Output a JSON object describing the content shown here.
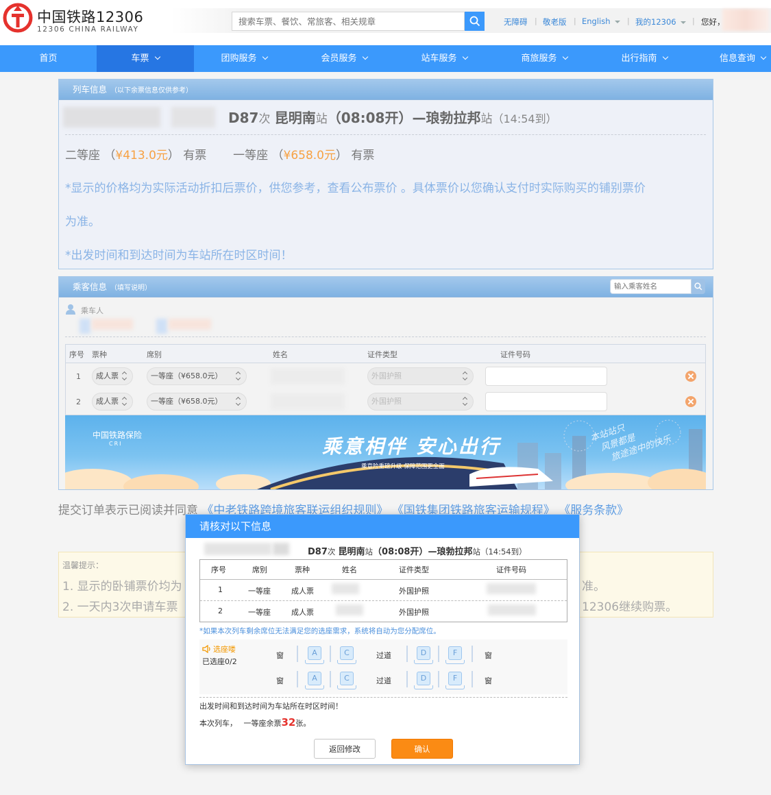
{
  "header": {
    "logo_cn": "中国铁路12306",
    "logo_en": "12306 CHINA RAILWAY",
    "search_placeholder": "搜索车票、餐饮、常旅客、相关规章",
    "links": [
      "无障碍",
      "敬老版",
      "English",
      "我的12306"
    ],
    "greeting": "您好，",
    "brand_color": "#3b99fc"
  },
  "nav": {
    "items": [
      {
        "label": "首页"
      },
      {
        "label": "车票"
      },
      {
        "label": "团购服务"
      },
      {
        "label": "会员服务"
      },
      {
        "label": "站车服务"
      },
      {
        "label": "商旅服务"
      },
      {
        "label": "出行指南"
      },
      {
        "label": "信息查询"
      }
    ],
    "active": "车票"
  },
  "train_info": {
    "title": "列车信息",
    "subtitle": "（以下余票信息仅供参考）",
    "train_no": "D87",
    "train_suffix": "次",
    "from_station": "昆明南",
    "station_suffix": "站",
    "depart": "（08:08开）",
    "dash": "—",
    "to_station": "琅勃拉邦",
    "arrive": "（14:54到）",
    "seats": [
      {
        "name": "二等座",
        "price": "¥413.0元",
        "status": "有票"
      },
      {
        "name": "一等座",
        "price": "¥658.0元",
        "status": "有票"
      }
    ],
    "note1_a": "*显示的价格均为实际活动折扣后票价，供您参考，查看公布票价 。具体票价以您确认支付时实际购买的铺别票价",
    "note1_b": "为准。",
    "note2": "*出发时间和到达时间为车站所在时区时间！",
    "price_color": "#f7a142"
  },
  "passenger": {
    "title": "乘客信息",
    "subtitle": "（填写说明）",
    "search_placeholder": "输入乘客姓名",
    "label": "乘车人",
    "columns": [
      "序号",
      "票种",
      "席别",
      "姓名",
      "证件类型",
      "证件号码"
    ],
    "rows": [
      {
        "no": "1",
        "ticket_type": "成人票",
        "seat": "一等座（¥658.0元）",
        "id_type": "外国护照"
      },
      {
        "no": "2",
        "ticket_type": "成人票",
        "seat": "一等座（¥658.0元）",
        "id_type": "外国护照"
      }
    ]
  },
  "banner": {
    "logo": "中国铁路保险",
    "logo_en": "CRI",
    "slogan": "乘意相伴  安心出行",
    "sub": "乘意险重磅升级  保障范围更全面",
    "script_1": "本站站只",
    "script_2": "风景都是",
    "script_3": "旅途途中的快乐"
  },
  "agreement": {
    "prefix": "提交订单表示已阅读并同意",
    "links": [
      "《中老铁路跨境旅客联运组织规则》",
      "《国铁集团铁路旅客运输规程》",
      "《服务条款》"
    ]
  },
  "tips": {
    "title": "温馨提示：",
    "line1": "1. 显示的卧铺票价均为",
    "line1_end": "准。",
    "line2": "2. 一天内3次申请车票",
    "line2_end": "12306继续购票。"
  },
  "dialog": {
    "title": "请核对以下信息",
    "train_no": "D87",
    "train_suffix": "次",
    "from_station": "昆明南",
    "station_suffix": "站",
    "depart": "（08:08开）",
    "dash": "—",
    "to_station": "琅勃拉邦",
    "arrive": "（14:54到）",
    "columns": [
      "序号",
      "席别",
      "票种",
      "姓名",
      "证件类型",
      "证件号码"
    ],
    "rows": [
      {
        "no": "1",
        "seat": "一等座",
        "ticket_type": "成人票",
        "id_type": "外国护照"
      },
      {
        "no": "2",
        "seat": "一等座",
        "ticket_type": "成人票",
        "id_type": "外国护照"
      }
    ],
    "warning": "*如果本次列车剩余席位无法满足您的选座需求，系统将自动为您分配席位。",
    "seat_pref_label": "选座喽",
    "seat_count": "已选座0/2",
    "window_label": "窗",
    "aisle_label": "过道",
    "seat_letters": [
      "A",
      "C",
      "D",
      "F"
    ],
    "time_note": "出发时间和到达时间为车站所在时区时间！",
    "remain_prefix": "本次列车，",
    "remain_seat": "一等座余票",
    "remain_count": "32",
    "remain_unit": "张。",
    "back_button": "返回修改",
    "confirm_button": "确认",
    "confirm_color": "#fb8b14"
  }
}
